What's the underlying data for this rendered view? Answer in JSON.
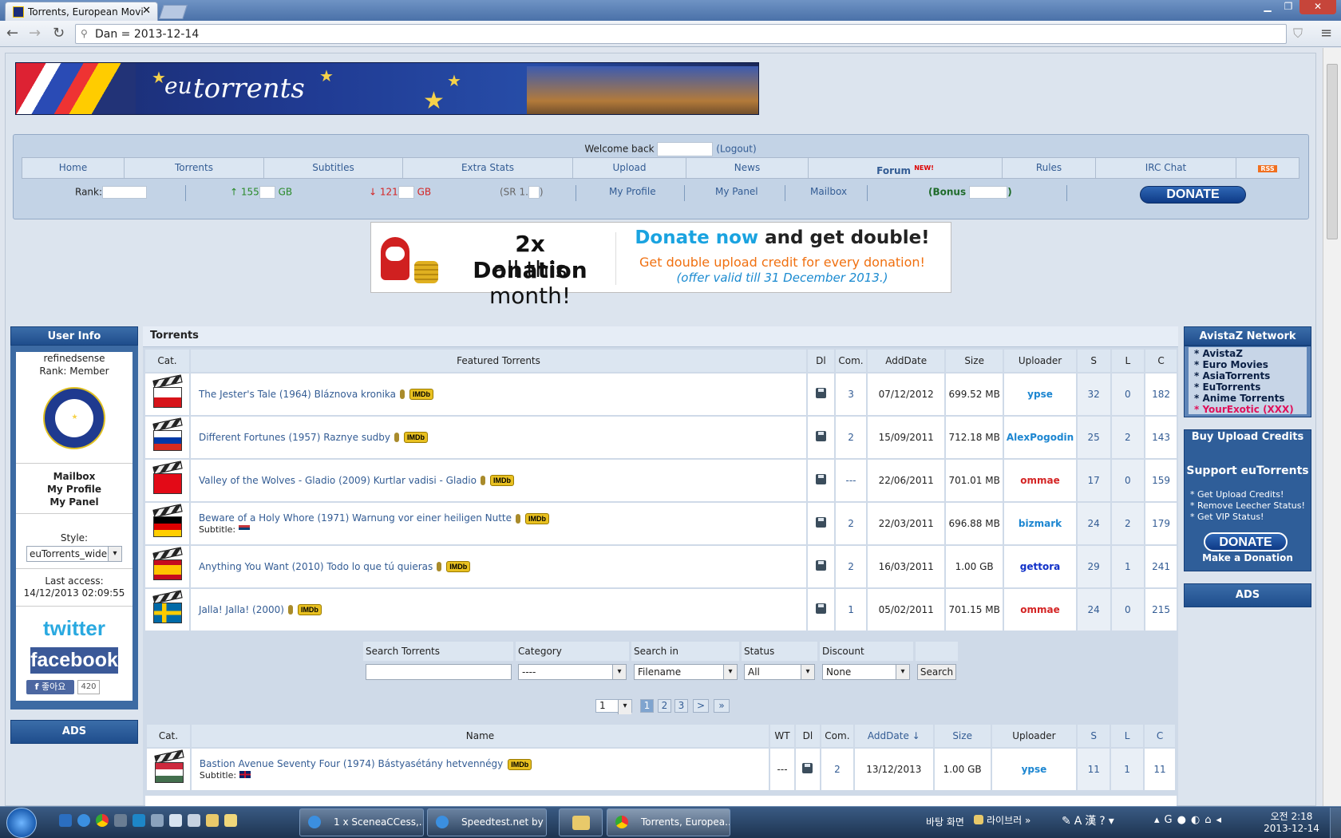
{
  "browser": {
    "tab_title": "Torrents, European Movie",
    "address": "Dan = 2013-12-14"
  },
  "header": {
    "logo_text": "torrents",
    "logo_prefix": "eu",
    "welcome": "Welcome back",
    "logout": "(Logout)"
  },
  "menu": [
    "Home",
    "Torrents",
    "Subtitles",
    "Extra Stats",
    "Upload",
    "News",
    "Forum",
    "Rules",
    "IRC Chat",
    "RSS"
  ],
  "forum_badge": "NEW!",
  "stats": {
    "rank_label": "Rank:",
    "up": "↑ 155",
    "up_unit": "GB",
    "down": "↓ 121",
    "down_unit": "GB",
    "sr": "(SR 1.",
    "sr_close": ")",
    "my_profile": "My Profile",
    "my_panel": "My Panel",
    "mailbox": "Mailbox",
    "bonus": "(Bonus",
    "bonus_close": ")",
    "donate": "DONATE"
  },
  "promo": {
    "headline1": "2x Donation",
    "headline2": "all this month!",
    "donate_now": "Donate now",
    "and_get": "and get double!",
    "line2": "Get double upload credit for every donation!",
    "line3": "(offer valid till 31 December 2013.)"
  },
  "user_info": {
    "title": "User Info",
    "username": "refinedsense",
    "rank": "Rank: Member",
    "mailbox": "Mailbox",
    "my_profile": "My Profile",
    "my_panel": "My Panel",
    "style_label": "Style:",
    "style_value": "euTorrents_wide",
    "last_access_label": "Last access:",
    "last_access": "14/12/2013 02:09:55",
    "twitter": "twitter",
    "facebook": "facebook",
    "like": "좋아요",
    "like_count": "420",
    "ads": "ADS"
  },
  "network": {
    "title": "AvistaZ Network",
    "items": [
      "* AvistaZ",
      "* Euro Movies",
      "* AsiaTorrents",
      "* EuTorrents",
      "* Anime Torrents"
    ],
    "exotic": "* YourExotic (XXX)"
  },
  "credits": {
    "title": "Buy Upload Credits",
    "support": "Support euTorrents",
    "items": [
      "* Get Upload Credits!",
      "* Remove Leecher Status!",
      "* Get VIP Status!"
    ],
    "donate": "DONATE",
    "make": "Make a Donation",
    "ads": "ADS"
  },
  "torrents": {
    "section_title": "Torrents",
    "featured_headers": [
      "Cat.",
      "Featured Torrents",
      "Dl",
      "Com.",
      "AddDate",
      "Size",
      "Uploader",
      "S",
      "L",
      "C"
    ],
    "featured": [
      {
        "flag": "cz",
        "name": "The Jester's Tale (1964) Bláznova kronika",
        "subtitle": "",
        "com": "3",
        "date": "07/12/2012",
        "size": "699.52 MB",
        "uploader": "ypse",
        "ucolor": "blue",
        "s": "32",
        "l": "0",
        "c": "182"
      },
      {
        "flag": "ru",
        "name": "Different Fortunes (1957) Raznye sudby",
        "subtitle": "",
        "com": "2",
        "date": "15/09/2011",
        "size": "712.18 MB",
        "uploader": "AlexPogodin",
        "ucolor": "blue",
        "s": "25",
        "l": "2",
        "c": "143"
      },
      {
        "flag": "tr",
        "name": "Valley of the Wolves - Gladio (2009) Kurtlar vadisi - Gladio",
        "subtitle": "",
        "com": "---",
        "date": "22/06/2011",
        "size": "701.01 MB",
        "uploader": "ommae",
        "ucolor": "red",
        "s": "17",
        "l": "0",
        "c": "159"
      },
      {
        "flag": "de",
        "name": "Beware of a Holy Whore (1971) Warnung vor einer heiligen Nutte",
        "subtitle": "Subtitle:",
        "com": "2",
        "date": "22/03/2011",
        "size": "696.88 MB",
        "uploader": "bizmark",
        "ucolor": "blue",
        "s": "24",
        "l": "2",
        "c": "179"
      },
      {
        "flag": "es",
        "name": "Anything You Want (2010) Todo lo que tú quieras",
        "subtitle": "",
        "com": "2",
        "date": "16/03/2011",
        "size": "1.00 GB",
        "uploader": "gettora",
        "ucolor": "navy",
        "s": "29",
        "l": "1",
        "c": "241"
      },
      {
        "flag": "se",
        "name": "Jalla! Jalla! (2000)",
        "subtitle": "",
        "com": "1",
        "date": "05/02/2011",
        "size": "701.15 MB",
        "uploader": "ommae",
        "ucolor": "red",
        "s": "24",
        "l": "0",
        "c": "215"
      }
    ],
    "imdb": "IMDb",
    "search": {
      "labels": [
        "Search Torrents",
        "Category",
        "Search in",
        "Status",
        "Discount"
      ],
      "category": "----",
      "search_in": "Filename",
      "status": "All",
      "discount": "None",
      "button": "Search"
    },
    "pages": {
      "select": "1",
      "p1": "1",
      "p2": "2",
      "p3": "3",
      "next": ">",
      "last": "»"
    },
    "list_headers": [
      "Cat.",
      "Name",
      "WT",
      "Dl",
      "Com.",
      "AddDate ↓",
      "Size",
      "Uploader",
      "S",
      "L",
      "C"
    ],
    "list": [
      {
        "flag": "hu",
        "name": "Bastion Avenue Seventy Four (1974) Bástyasétány hetvennégy",
        "subtitle": "Subtitle:",
        "wt": "---",
        "com": "2",
        "date": "13/12/2013",
        "size": "1.00 GB",
        "uploader": "ypse",
        "s": "11",
        "l": "1",
        "c": "11"
      }
    ]
  },
  "taskbar": {
    "items": [
      "1 x SceneaCCess,...",
      "Speedtest.net by ...",
      "Torrents, Europea..."
    ],
    "desktop": "바탕 화면",
    "library": "라이브러",
    "time": "오전 2:18",
    "date": "2013-12-14"
  }
}
